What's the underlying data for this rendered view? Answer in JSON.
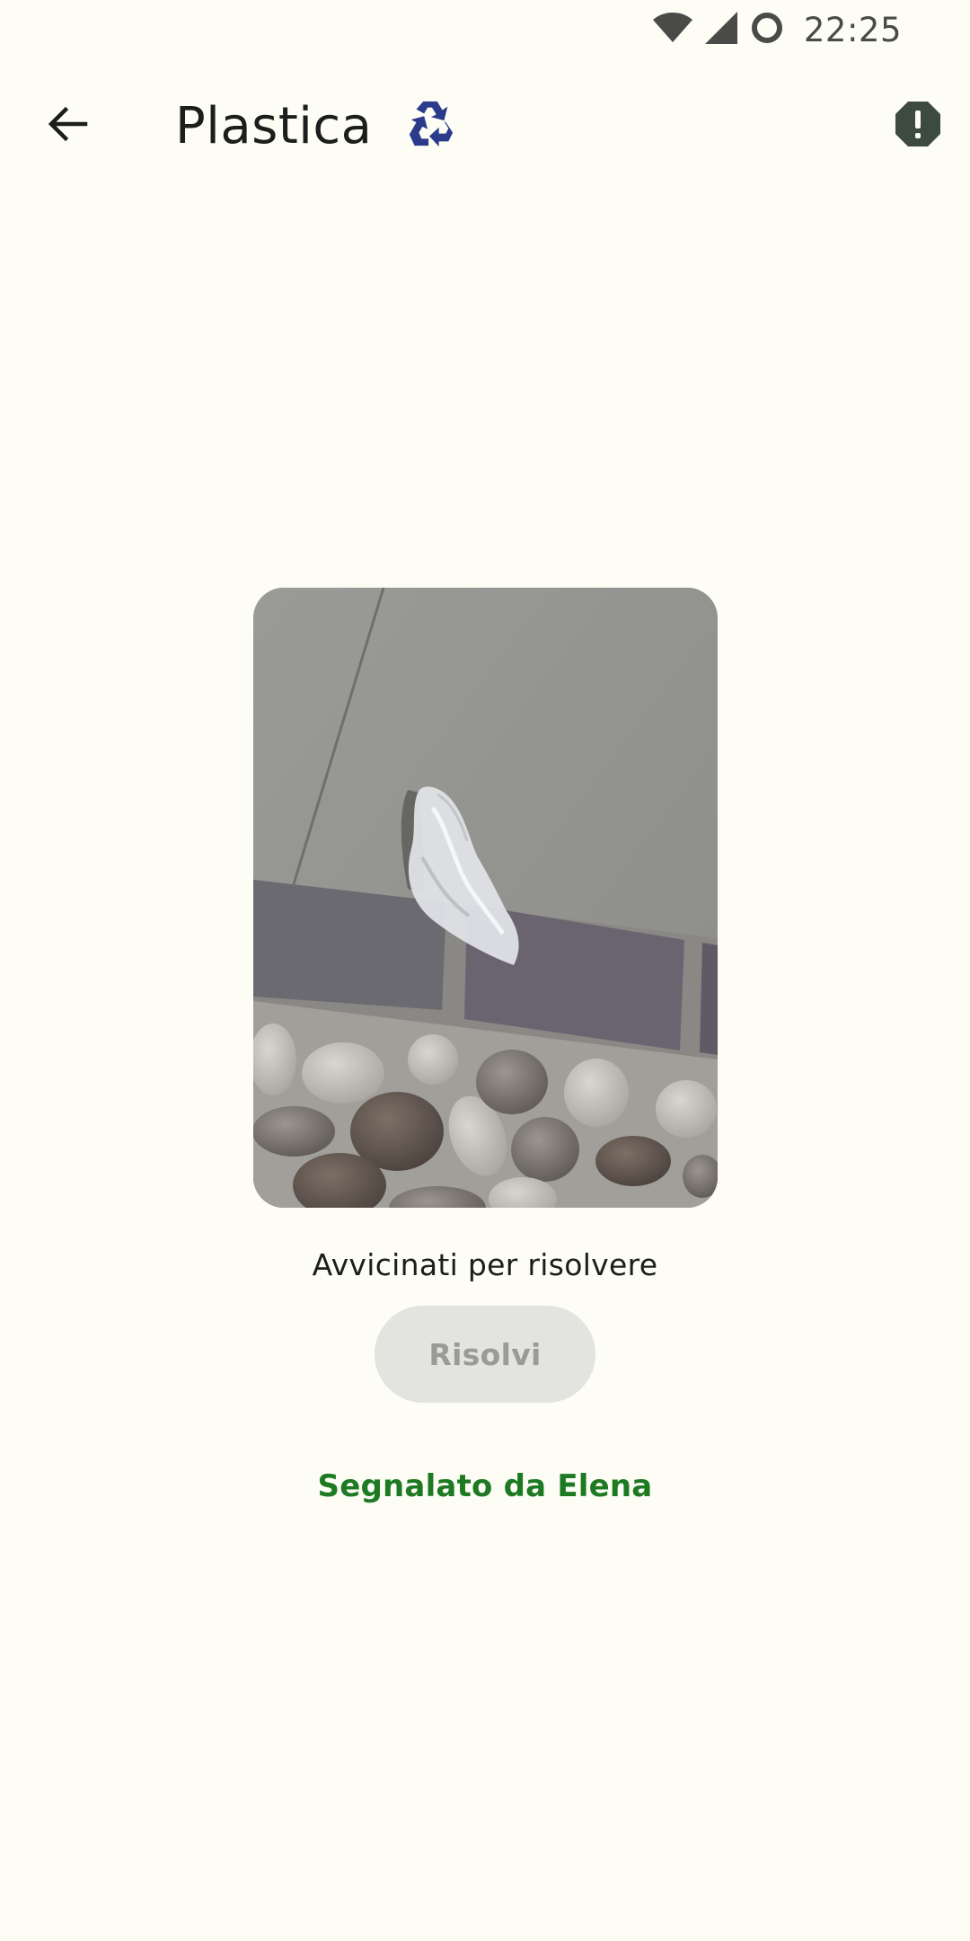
{
  "status_bar": {
    "time": "22:25",
    "icons": [
      "wifi-icon",
      "cell-signal-icon",
      "circle-status-icon"
    ]
  },
  "app_bar": {
    "title": "Plastica",
    "category_icon": "recycle-icon",
    "back_icon": "arrow-back-icon",
    "report_icon": "report-alert-icon"
  },
  "photo": {
    "description_icon": "waste-photo"
  },
  "content": {
    "hint": "Avvicinati per risolvere",
    "resolve_label": "Risolvi",
    "resolve_enabled": false,
    "reporter": "Segnalato da Elena"
  },
  "colors": {
    "background": "#fdfdf6",
    "reporter_green": "#1e7a22",
    "recycle_blue": "#2b3a8a",
    "disabled_button": "#e3e3df",
    "report_icon": "#3c4a40"
  }
}
